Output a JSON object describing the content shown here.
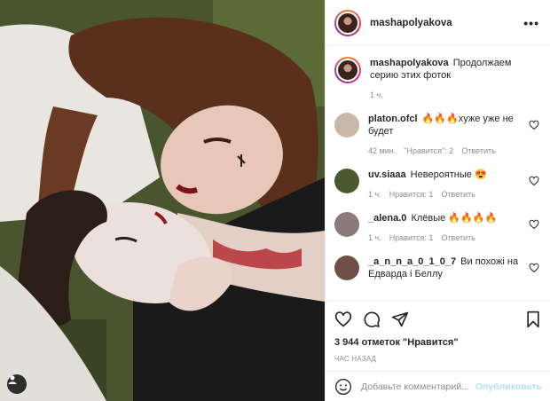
{
  "photo": {
    "alt_icon": "user-tag-icon"
  },
  "header": {
    "username": "mashapolyakova",
    "more_icon": "more-icon",
    "more_label": "•••"
  },
  "caption": {
    "username": "mashapolyakova",
    "text": "Продолжаем серию этих фоток",
    "time": "1 ч."
  },
  "comments": [
    {
      "username": "platon.ofcl",
      "text": "🔥🔥🔥хуже уже не будет",
      "time": "42 мин.",
      "likes": "\"Нравится\": 2",
      "reply": "Ответить",
      "avatar_color": "#c8b8a8"
    },
    {
      "username": "uv.siaaa",
      "text": "Невероятные 😍",
      "time": "1 ч.",
      "likes": "Нравится: 1",
      "reply": "Ответить",
      "avatar_color": "#4a5a2e"
    },
    {
      "username": "_alena.0",
      "text": "Клёвые 🔥🔥🔥🔥",
      "time": "1 ч.",
      "likes": "Нравится: 1",
      "reply": "Ответить",
      "avatar_color": "#8a7a78"
    },
    {
      "username": "_a_n_n_a_0_1_0_7",
      "text": "Ви похожі на Едварда і Беллу",
      "time": "",
      "likes": "",
      "reply": "",
      "avatar_color": "#6e5048"
    }
  ],
  "actions": {
    "like_icon": "heart-icon",
    "comment_icon": "comment-icon",
    "share_icon": "share-icon",
    "save_icon": "bookmark-icon"
  },
  "likes": "3 944 отметок \"Нравится\"",
  "posted_ago": "ЧАС НАЗАД",
  "add_comment": {
    "placeholder": "Добавьте комментарий...",
    "post_label": "Опубликовать",
    "emoji_icon": "emoji-icon"
  }
}
